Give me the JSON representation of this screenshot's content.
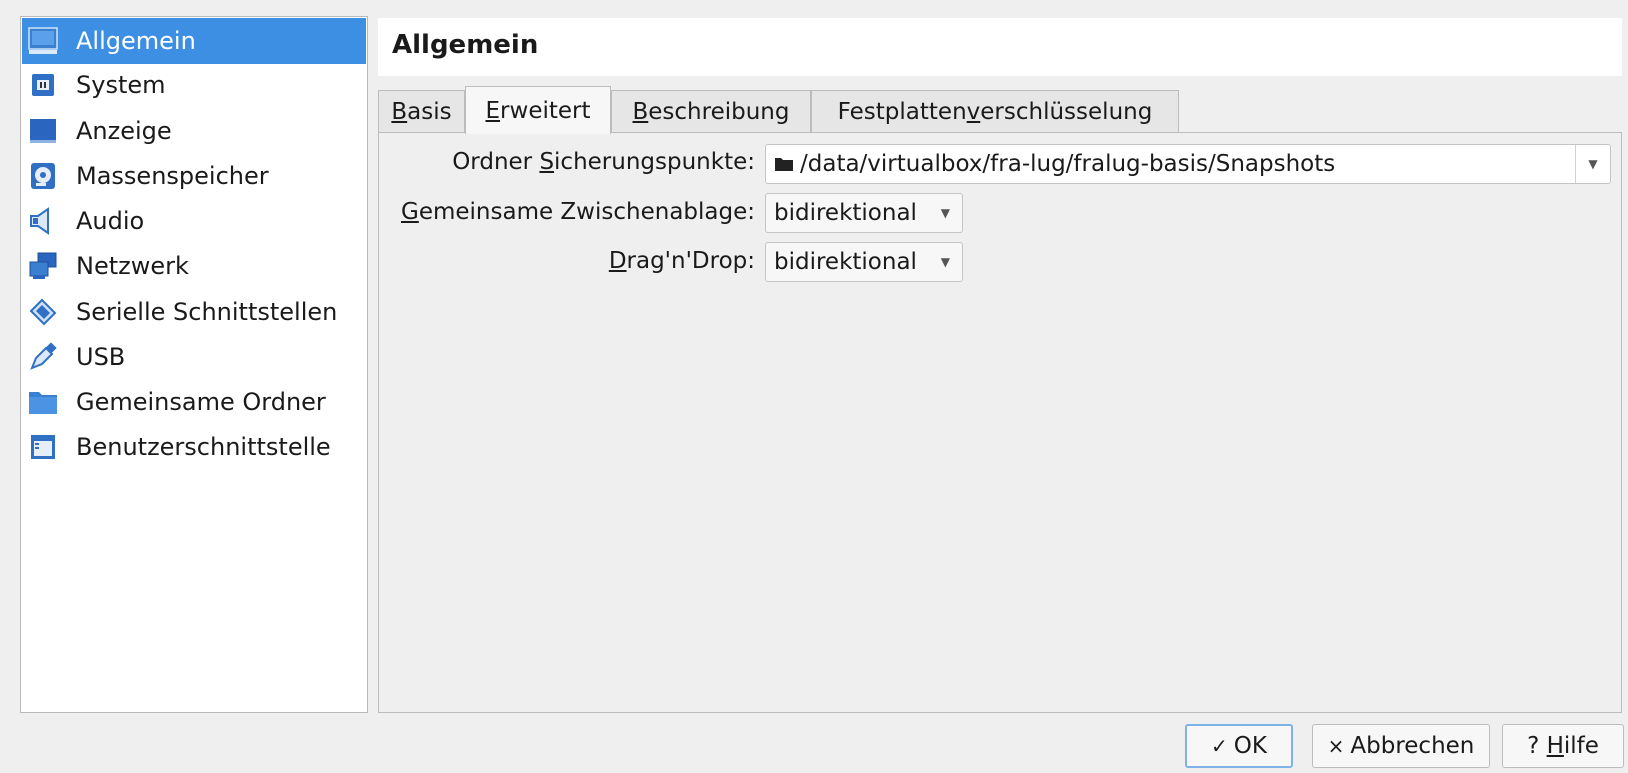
{
  "header": {
    "title": "Allgemein"
  },
  "sidebar": {
    "items": [
      {
        "label": "Allgemein",
        "icon": "monitor-icon"
      },
      {
        "label": "System",
        "icon": "chip-icon"
      },
      {
        "label": "Anzeige",
        "icon": "display-icon"
      },
      {
        "label": "Massenspeicher",
        "icon": "disk-icon"
      },
      {
        "label": "Audio",
        "icon": "speaker-icon"
      },
      {
        "label": "Netzwerk",
        "icon": "network-icon"
      },
      {
        "label": "Serielle Schnittstellen",
        "icon": "serial-port-icon"
      },
      {
        "label": "USB",
        "icon": "usb-icon"
      },
      {
        "label": "Gemeinsame Ordner",
        "icon": "folder-icon"
      },
      {
        "label": "Benutzerschnittstelle",
        "icon": "window-icon"
      }
    ],
    "selected_index": 0
  },
  "tabs": {
    "basis": {
      "mnemonic": "B",
      "rest": "asis"
    },
    "erweitert": {
      "mnemonic": "E",
      "rest": "rweitert"
    },
    "beschreibung": {
      "mnemonic": "B",
      "rest": "eschreibung"
    },
    "festplatten": {
      "pre": "Festplatten",
      "mnemonic": "v",
      "rest": "erschlüsselung"
    },
    "active": "Erweitert"
  },
  "form": {
    "snapshot_label": {
      "pre": "Ordner ",
      "mnemonic": "S",
      "rest": "icherungspunkte:"
    },
    "snapshot_value": "/data/virtualbox/fra-lug/fralug-basis/Snapshots",
    "clipboard_label": {
      "mnemonic": "G",
      "rest": "emeinsame Zwischenablage:"
    },
    "clipboard_value": "bidirektional",
    "dnd_label": {
      "mnemonic": "D",
      "rest": "rag'n'Drop:"
    },
    "dnd_value": "bidirektional"
  },
  "buttons": {
    "ok": "OK",
    "cancel": "Abbrechen",
    "help_pre": "? ",
    "help_mnemonic": "H",
    "help_rest": "ilfe"
  },
  "colors": {
    "selection": "#3d8fe3",
    "default_button_border": "#7fb2e8"
  }
}
